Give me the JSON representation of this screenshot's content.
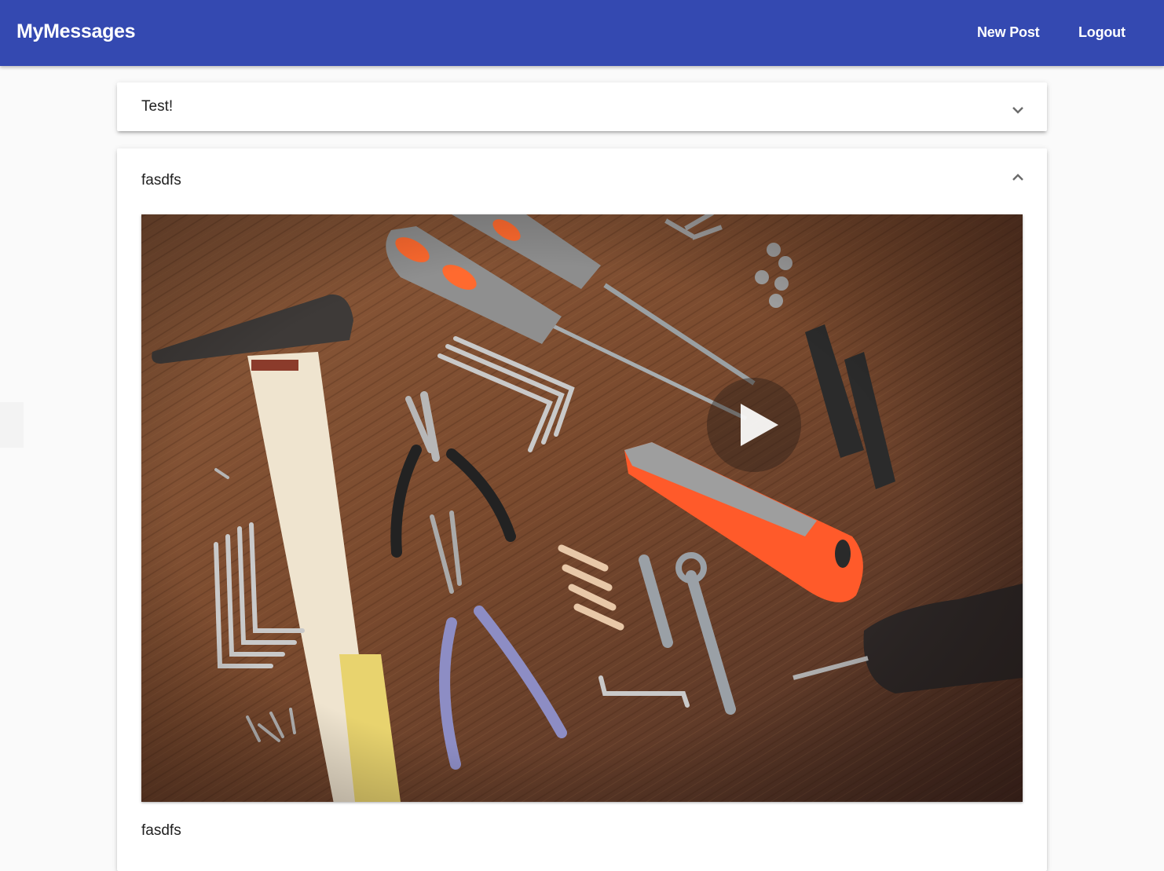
{
  "app": {
    "title": "MyMessages",
    "accent_color": "#3449b1"
  },
  "nav": {
    "new_post": "New Post",
    "logout": "Logout"
  },
  "posts": [
    {
      "title": "Test!",
      "expanded": false,
      "toggle_icon": "chevron-down-icon"
    },
    {
      "title": "fasdfs",
      "expanded": true,
      "toggle_icon": "chevron-up-icon",
      "media": {
        "type": "video",
        "thumbnail_subject": "tools on wooden table",
        "overlay_icon": "play-icon"
      },
      "caption": "fasdfs"
    }
  ]
}
